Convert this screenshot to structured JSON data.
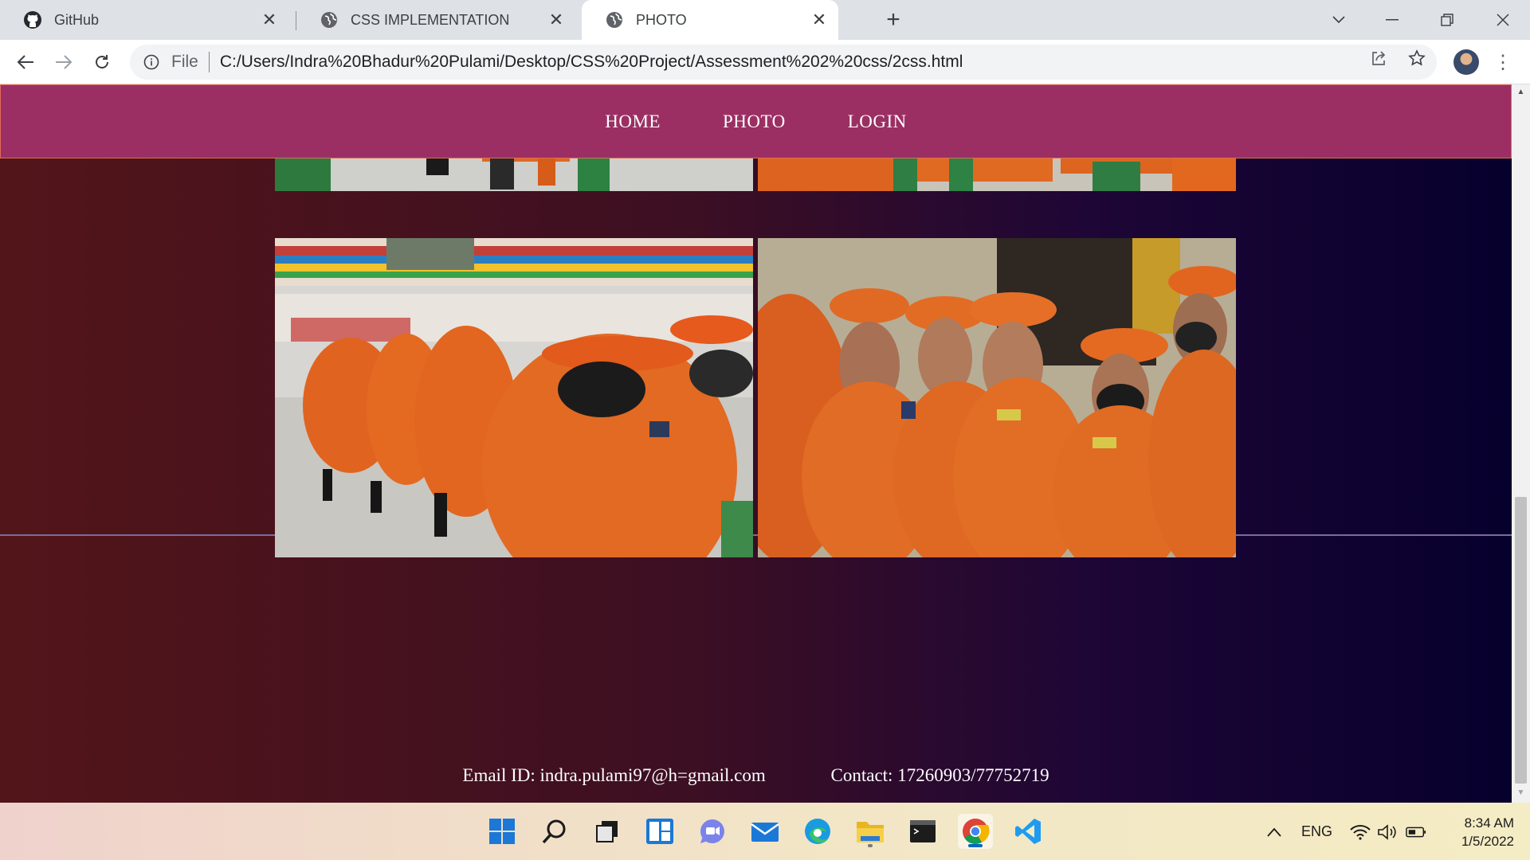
{
  "browser": {
    "tabs": [
      {
        "title": "GitHub",
        "icon": "github-icon"
      },
      {
        "title": "CSS IMPLEMENTATION",
        "icon": "globe-icon"
      },
      {
        "title": "PHOTO",
        "icon": "globe-icon",
        "active": true
      }
    ],
    "address_bar": {
      "scheme_label": "File",
      "url": "C:/Users/Indra%20Bhadur%20Pulami/Desktop/CSS%20Project/Assessment%202%20css/2css.html"
    }
  },
  "page": {
    "nav": {
      "links": [
        "HOME",
        "PHOTO",
        "LOGIN"
      ]
    },
    "footer": {
      "email": "Email ID: indra.pulami97@h=gmail.com",
      "contact": "Contact: 17260903/77752719"
    },
    "colors": {
      "nav_background": "#9b2f63",
      "gradient_left": "#521519",
      "gradient_right": "#06002d",
      "uniform_orange": "#e2621c"
    }
  },
  "taskbar": {
    "apps": [
      "start-icon",
      "search-icon",
      "task-view-icon",
      "widgets-icon",
      "chat-icon",
      "mail-icon",
      "edge-icon",
      "file-explorer-icon",
      "terminal-icon",
      "chrome-icon",
      "vscode-icon"
    ],
    "language": "ENG",
    "time": "8:34 AM",
    "date": "1/5/2022"
  }
}
